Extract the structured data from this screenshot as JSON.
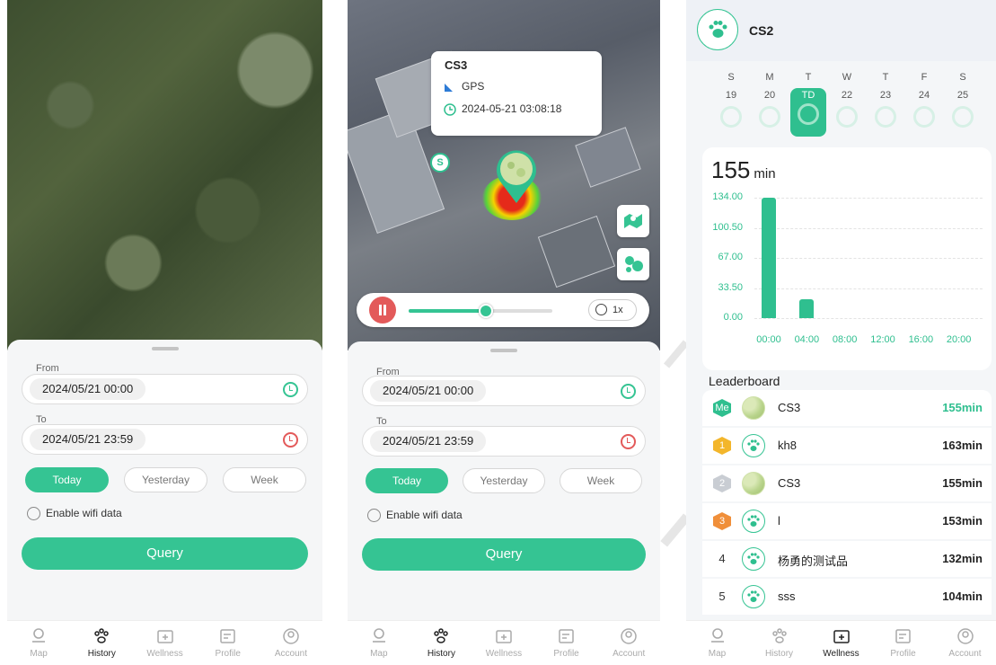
{
  "history": {
    "from_label": "From",
    "from_value": "2024/05/21 00:00",
    "to_label": "To",
    "to_value": "2024/05/21 23:59",
    "chips": [
      "Today",
      "Yesterday",
      "Week"
    ],
    "active_chip": "Today",
    "wifi_label": "Enable wifi data",
    "query_label": "Query"
  },
  "map_popup": {
    "device_name": "CS3",
    "source": "GPS",
    "timestamp": "2024-05-21 03:08:18"
  },
  "playback": {
    "speed": "1x",
    "progress": 0.54
  },
  "start_marker": "S",
  "nav": {
    "items": [
      "Map",
      "History",
      "Wellness",
      "Profile",
      "Account"
    ]
  },
  "wellness": {
    "pet_name": "CS2",
    "days": [
      {
        "weekday": "S",
        "date": "19"
      },
      {
        "weekday": "M",
        "date": "20"
      },
      {
        "weekday": "T",
        "date": "TD"
      },
      {
        "weekday": "W",
        "date": "22"
      },
      {
        "weekday": "T",
        "date": "23"
      },
      {
        "weekday": "F",
        "date": "24"
      },
      {
        "weekday": "S",
        "date": "25"
      }
    ],
    "total_value": "155",
    "total_unit": "min",
    "leaderboard_title": "Leaderboard",
    "leaderboard": [
      {
        "rank": "Me",
        "name": "CS3",
        "value": "155min"
      },
      {
        "rank": "1",
        "name": "kh8",
        "value": "163min"
      },
      {
        "rank": "2",
        "name": "CS3",
        "value": "155min"
      },
      {
        "rank": "3",
        "name": "l",
        "value": "153min"
      },
      {
        "rank": "4",
        "name": "杨勇的测试品",
        "value": "132min"
      },
      {
        "rank": "5",
        "name": "sss",
        "value": "104min"
      }
    ]
  },
  "chart_data": {
    "type": "bar",
    "categories": [
      "00:00",
      "04:00",
      "08:00",
      "12:00",
      "16:00",
      "20:00"
    ],
    "x_ticks": [
      "00:00",
      "04:00",
      "08:00",
      "12:00",
      "16:00",
      "20:00"
    ],
    "y_ticks": [
      "134.00",
      "100.50",
      "67.00",
      "33.50",
      "0.00"
    ],
    "ylim": [
      0,
      134
    ],
    "series": [
      {
        "values": [
          134,
          21,
          0,
          0,
          0,
          0
        ]
      }
    ],
    "color": "#2fbf8f"
  },
  "colors": {
    "accent": "#35c493",
    "danger": "#e35a5a"
  }
}
